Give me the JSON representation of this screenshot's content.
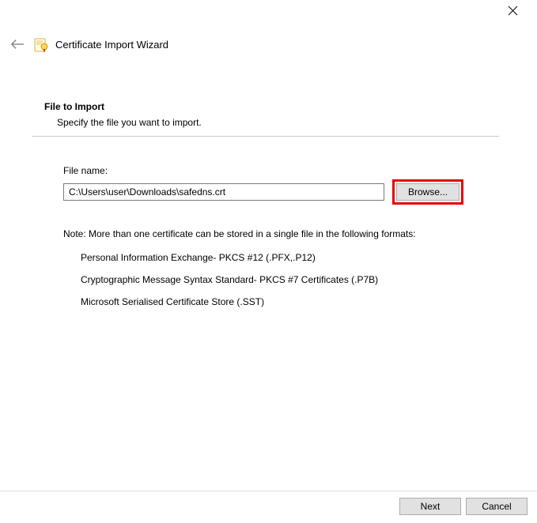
{
  "titlebar": {},
  "header": {
    "title": "Certificate Import Wizard"
  },
  "page": {
    "section_title": "File to Import",
    "section_desc": "Specify the file you want to import.",
    "file_label": "File name:",
    "file_value": "C:\\Users\\user\\Downloads\\safedns.crt",
    "browse_label": "Browse...",
    "note": "Note:  More than one certificate can be stored in a single file in the following formats:",
    "formats": [
      "Personal Information Exchange- PKCS #12 (.PFX,.P12)",
      "Cryptographic Message Syntax Standard- PKCS #7 Certificates (.P7B)",
      "Microsoft Serialised Certificate Store (.SST)"
    ]
  },
  "footer": {
    "next": "Next",
    "cancel": "Cancel"
  }
}
